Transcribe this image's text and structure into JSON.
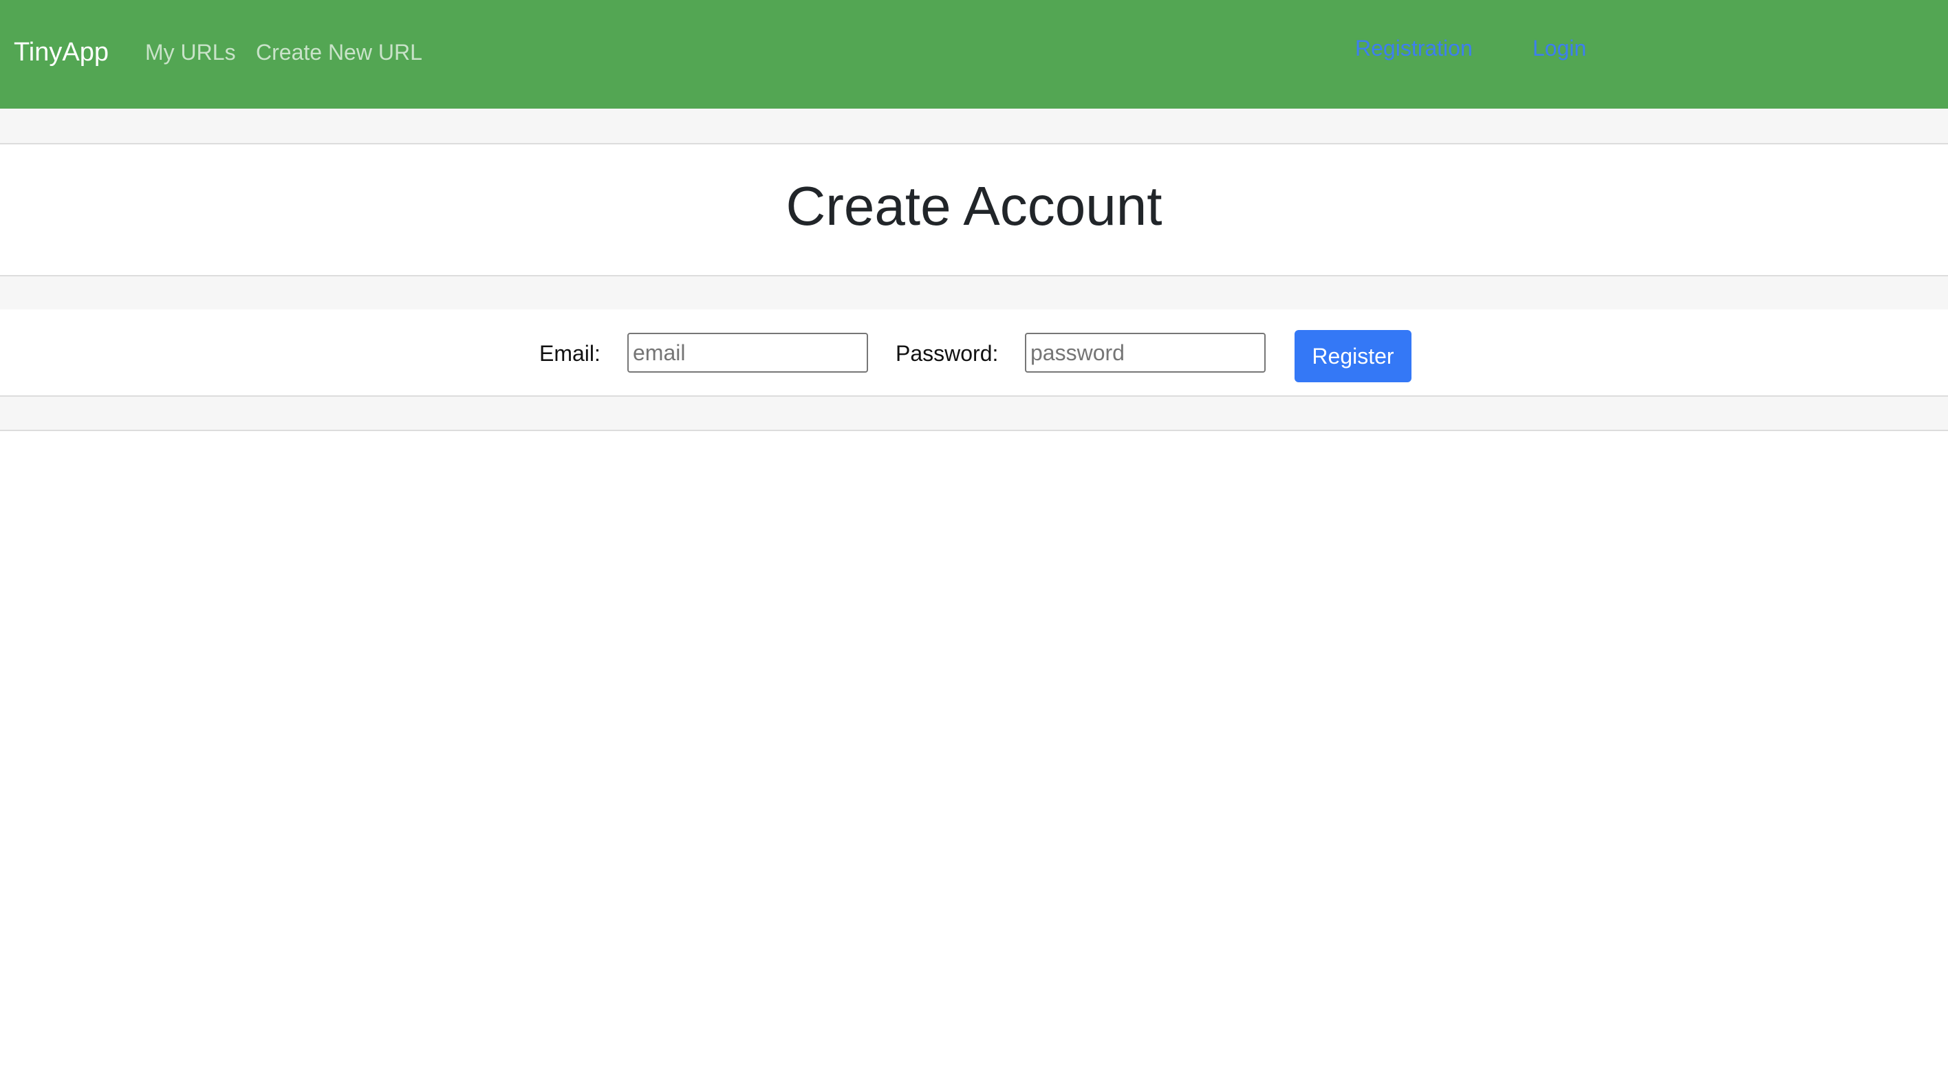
{
  "navbar": {
    "brand": "TinyApp",
    "links": [
      {
        "label": "My URLs"
      },
      {
        "label": "Create New URL"
      }
    ],
    "right_links": [
      {
        "label": "Registration"
      },
      {
        "label": "Login"
      }
    ]
  },
  "main": {
    "title": "Create Account",
    "form": {
      "email_label": "Email:",
      "email_placeholder": "email",
      "email_value": "",
      "password_label": "Password:",
      "password_placeholder": "password",
      "password_value": "",
      "submit_label": "Register"
    }
  },
  "colors": {
    "navbar_bg": "#53a653",
    "link_blue": "#3d7ef0",
    "button_blue": "#3478f6",
    "band_gray": "#f6f6f6"
  }
}
